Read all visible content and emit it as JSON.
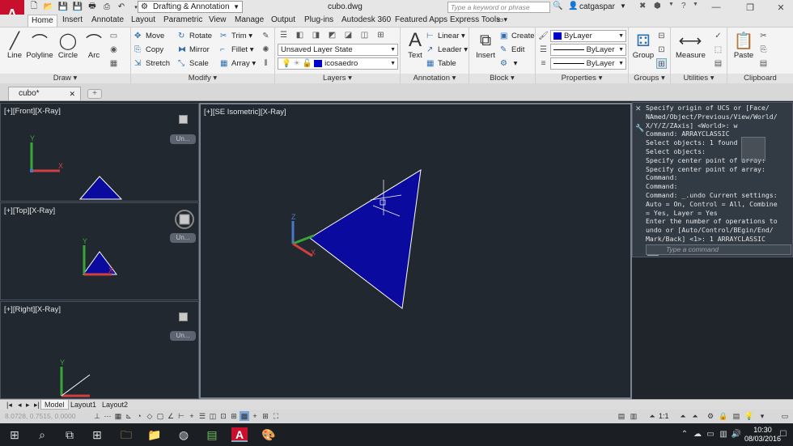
{
  "titlebar": {
    "app_letter": "A",
    "workspace": "Drafting & Annotation",
    "filename": "cubo.dwg",
    "search_placeholder": "Type a keyword or phrase",
    "username": "catgaspar"
  },
  "ribbon_tabs": [
    "Home",
    "Insert",
    "Annotate",
    "Layout",
    "Parametric",
    "View",
    "Manage",
    "Output",
    "Plug-ins",
    "Autodesk 360",
    "Featured Apps",
    "Express Tools"
  ],
  "panels": {
    "draw": {
      "title": "Draw",
      "line": "Line",
      "polyline": "Polyline",
      "circle": "Circle",
      "arc": "Arc"
    },
    "modify": {
      "title": "Modify",
      "move": "Move",
      "rotate": "Rotate",
      "trim": "Trim",
      "copy": "Copy",
      "mirror": "Mirror",
      "fillet": "Fillet",
      "stretch": "Stretch",
      "scale": "Scale",
      "array": "Array"
    },
    "layers": {
      "title": "Layers",
      "layer_state": "Unsaved Layer State",
      "current_layer": "icosaedro"
    },
    "annotation": {
      "title": "Annotation",
      "text": "Text",
      "linear": "Linear",
      "leader": "Leader",
      "table": "Table"
    },
    "block": {
      "title": "Block",
      "insert": "Insert",
      "create": "Create",
      "edit": "Edit"
    },
    "properties": {
      "title": "Properties",
      "color": "ByLayer",
      "linetype": "ByLayer",
      "lineweight": "ByLayer"
    },
    "groups": {
      "title": "Groups",
      "group": "Group"
    },
    "utilities": {
      "title": "Utilities",
      "measure": "Measure"
    },
    "clipboard": {
      "title": "Clipboard",
      "paste": "Paste"
    }
  },
  "file_tab": "cubo*",
  "viewports": {
    "front": {
      "label": "[+][Front][X-Ray]",
      "unnamed": "Un..."
    },
    "top": {
      "label": "[+][Top][X-Ray]",
      "unnamed": "Un..."
    },
    "right": {
      "label": "[+][Right][X-Ray]",
      "unnamed": "Un..."
    },
    "main": {
      "label": "[+][SE Isometric][X-Ray]"
    }
  },
  "command": {
    "history": "Specify origin of UCS or [Face/\nNAmed/Object/Previous/View/World/\nX/Y/Z/ZAxis] <World>: w\nCommand: ARRAYCLASSIC\nSelect objects: 1 found\nSelect objects:\nSpecify center point of array:\nSpecify center point of array:\nCommand:\nCommand:\nCommand: _.undo Current settings:\nAuto = On, Control = All, Combine\n= Yes, Layer = Yes\nEnter the number of operations to\nundo or [Auto/Control/BEgin/End/\nMark/Back] <1>: 1 ARRAYCLASSIC",
    "placeholder": "Type a command"
  },
  "layout_tabs": [
    "Model",
    "Layout1",
    "Layout2"
  ],
  "status": {
    "coords": "8.0728, 0.7515, 0.0000",
    "scale": "1:1"
  },
  "clock": {
    "time": "10:30",
    "date": "08/03/2016"
  },
  "colors": {
    "shape_fill": "#0a0a9e",
    "viewport_bg": "#212830",
    "accent_red": "#c8102e"
  }
}
